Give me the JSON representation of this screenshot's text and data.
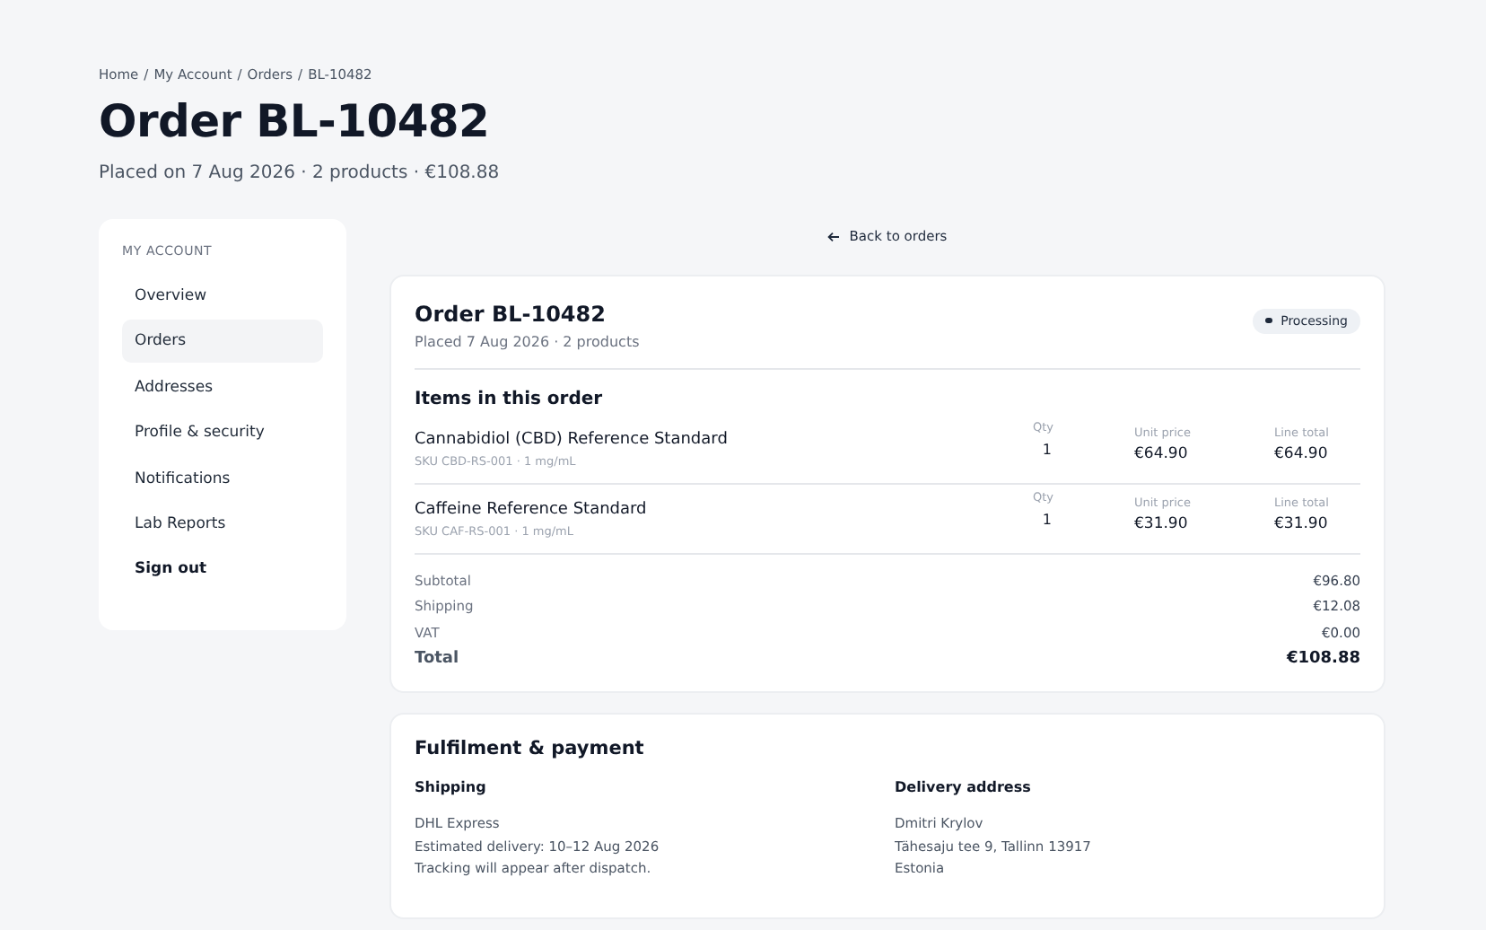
{
  "breadcrumb": [
    "Home",
    "My Account",
    "Orders",
    "BL-10482"
  ],
  "breadcrumb_separator": "/",
  "page_title": "Order BL-10482",
  "page_subtitle": "Placed on 7 Aug 2026 · 2 products · €108.88",
  "sidebar": {
    "heading": "MY ACCOUNT",
    "items": [
      {
        "label": "Overview",
        "selected": false,
        "kind": "link"
      },
      {
        "label": "Orders",
        "selected": true,
        "kind": "link"
      },
      {
        "label": "Addresses",
        "selected": false,
        "kind": "link"
      },
      {
        "label": "Profile & security",
        "selected": false,
        "kind": "link"
      },
      {
        "label": "Notifications",
        "selected": false,
        "kind": "link"
      },
      {
        "label": "Lab Reports",
        "selected": false,
        "kind": "link"
      },
      {
        "label": "Sign out",
        "selected": false,
        "kind": "action"
      }
    ]
  },
  "back_link": "Back to orders",
  "order_card": {
    "title": "Order BL-10482",
    "subtitle": "Placed 7 Aug 2026 · 2 products",
    "status": "Processing",
    "items_heading": "Items in this order",
    "items": [
      {
        "name": "Cannabidiol (CBD) Reference Standard",
        "sku": "SKU CBD-RS-001 · 1 mg/mL",
        "qty_label": "Qty",
        "qty": "1",
        "unit_label": "Unit price",
        "unit_price": "€64.90",
        "total_label": "Line total",
        "line_total": "€64.90"
      },
      {
        "name": "Caffeine Reference Standard",
        "sku": "SKU CAF-RS-001 · 1 mg/mL",
        "qty_label": "Qty",
        "qty": "1",
        "unit_label": "Unit price",
        "unit_price": "€31.90",
        "total_label": "Line total",
        "line_total": "€31.90"
      }
    ],
    "summary": [
      {
        "label": "Subtotal",
        "value": "€96.80",
        "kind": "line"
      },
      {
        "label": "Shipping",
        "value": "€12.08",
        "kind": "line"
      },
      {
        "label": "VAT",
        "value": "€0.00",
        "kind": "line"
      },
      {
        "label": "Total",
        "value": "€108.88",
        "kind": "total"
      }
    ]
  },
  "fulfilment_card": {
    "title": "Fulfilment & payment",
    "columns": [
      {
        "heading": "Shipping",
        "lines": [
          "DHL Express",
          "Estimated delivery: 10–12 Aug 2026",
          "Tracking will appear after dispatch."
        ]
      },
      {
        "heading": "Delivery address",
        "lines": [
          "Dmitri Krylov",
          "Tähesaju tee 9, Tallinn 13917",
          "Estonia"
        ]
      }
    ]
  }
}
